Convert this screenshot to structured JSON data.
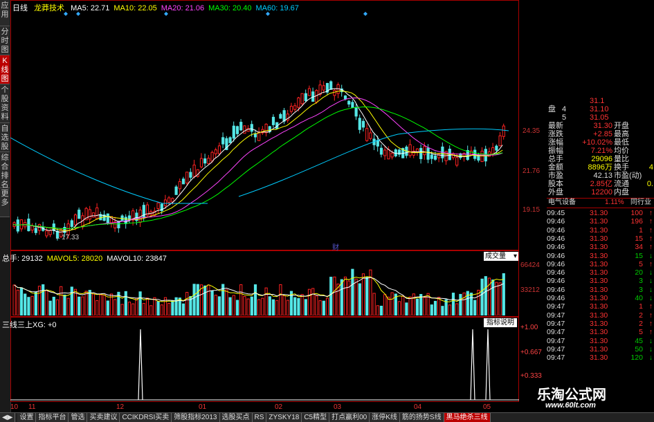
{
  "left_tabs": [
    "应用",
    "分时图",
    "K线图",
    "个股资料",
    "自选股",
    "综合排名",
    "更多"
  ],
  "main": {
    "period": "日线",
    "indicator": "龙莽技术",
    "ma": [
      {
        "label": "MA5: 22.71",
        "color": "#ffffff"
      },
      {
        "label": "MA10: 22.05",
        "color": "#ffff00"
      },
      {
        "label": "MA20: 21.06",
        "color": "#ff44ff"
      },
      {
        "label": "MA30: 20.40",
        "color": "#00ff00"
      },
      {
        "label": "MA60: 19.67",
        "color": "#00ccff"
      }
    ],
    "y_labels": [
      "24.35",
      "21.76",
      "19.15"
    ],
    "low_marker": "←17.33",
    "fin_marker": "财"
  },
  "volume": {
    "header": [
      {
        "label": "总手: 29132",
        "color": "#ffffff"
      },
      {
        "label": "MAVOL5: 28020",
        "color": "#ffff00"
      },
      {
        "label": "MAVOL10: 23847",
        "color": "#ffffff"
      }
    ],
    "selector": "成交量",
    "y_labels": [
      "66424",
      "33212"
    ]
  },
  "indicator_pane": {
    "header": "三线三上XG: +0",
    "button": "指标说明",
    "y_labels": [
      "+1.00",
      "+0.667",
      "+0.333"
    ]
  },
  "x_axis": [
    "10",
    "11",
    "12",
    "01",
    "02",
    "03",
    "04",
    "05"
  ],
  "quote": {
    "top_rows": [
      {
        "label": "",
        "num": "",
        "price": "31.1"
      },
      {
        "label": "盘",
        "num": "4",
        "price": "31.10"
      },
      {
        "label": "",
        "num": "5",
        "price": "31.05"
      }
    ],
    "rows": [
      {
        "k1": "最新",
        "v1": "31.30",
        "k2": "开盘",
        "v2": ""
      },
      {
        "k1": "涨跌",
        "v1": "+2.85",
        "k2": "最高",
        "v2": ""
      },
      {
        "k1": "涨幅",
        "v1": "+10.02%",
        "k2": "最低",
        "v2": ""
      },
      {
        "k1": "振幅",
        "v1": "7.21%",
        "k2": "均价",
        "v2": ""
      },
      {
        "k1": "总手",
        "v1": "29096",
        "k2": "量比",
        "v2": ""
      },
      {
        "k1": "金额",
        "v1": "8896万",
        "k2": "换手",
        "v2": "4"
      },
      {
        "k1": "市盈",
        "v1": "42.13",
        "k2": "市盈(动)",
        "v2": ""
      },
      {
        "k1": "股本",
        "v1": "2.85亿",
        "k2": "流通",
        "v2": "0."
      },
      {
        "k1": "外盘",
        "v1": "12200",
        "k2": "内盘",
        "v2": ""
      }
    ],
    "industry": {
      "name": "电气设备",
      "pct": "1.11%",
      "label": "同行业"
    },
    "ticks": [
      {
        "t": "09:45",
        "p": "31.30",
        "v": "100",
        "a": "↑",
        "d": false
      },
      {
        "t": "09:46",
        "p": "31.30",
        "v": "196",
        "a": "↑",
        "d": false
      },
      {
        "t": "09:46",
        "p": "31.30",
        "v": "1",
        "a": "↑",
        "d": false
      },
      {
        "t": "09:46",
        "p": "31.30",
        "v": "15",
        "a": "↑",
        "d": false
      },
      {
        "t": "09:46",
        "p": "31.30",
        "v": "34",
        "a": "↑",
        "d": false
      },
      {
        "t": "09:46",
        "p": "31.30",
        "v": "15",
        "a": "↓",
        "d": true
      },
      {
        "t": "09:46",
        "p": "31.30",
        "v": "5",
        "a": "↑",
        "d": false
      },
      {
        "t": "09:46",
        "p": "31.30",
        "v": "20",
        "a": "↓",
        "d": true
      },
      {
        "t": "09:46",
        "p": "31.30",
        "v": "3",
        "a": "↓",
        "d": true
      },
      {
        "t": "09:46",
        "p": "31.30",
        "v": "3",
        "a": "↓",
        "d": true
      },
      {
        "t": "09:46",
        "p": "31.30",
        "v": "40",
        "a": "↓",
        "d": true
      },
      {
        "t": "09:47",
        "p": "31.30",
        "v": "1",
        "a": "↑",
        "d": false
      },
      {
        "t": "09:47",
        "p": "31.30",
        "v": "2",
        "a": "↑",
        "d": false
      },
      {
        "t": "09:47",
        "p": "31.30",
        "v": "2",
        "a": "↑",
        "d": false
      },
      {
        "t": "09:47",
        "p": "31.30",
        "v": "5",
        "a": "↑",
        "d": false
      },
      {
        "t": "09:47",
        "p": "31.30",
        "v": "45",
        "a": "↓",
        "d": true
      },
      {
        "t": "09:47",
        "p": "31.30",
        "v": "50",
        "a": "↓",
        "d": true
      },
      {
        "t": "09:47",
        "p": "31.30",
        "v": "120",
        "a": "↓",
        "d": true
      }
    ]
  },
  "bottom_tabs": [
    "设置",
    "指标平台",
    "管选",
    "买卖建议",
    "CCIKDRSI买卖",
    "筛股指标2013",
    "选股买点",
    "RS",
    "ZYSKY18",
    "C5精型",
    "打点赢利00",
    "涨停K线",
    "筋的扬势S线",
    "黑马绝杀三线"
  ],
  "bottom_active": 13,
  "watermark": {
    "title": "乐淘公式网",
    "url": "www.60lt.com"
  },
  "colors": {
    "up": "#ff2222",
    "down": "#55e6e6",
    "frame": "#aa0000"
  }
}
